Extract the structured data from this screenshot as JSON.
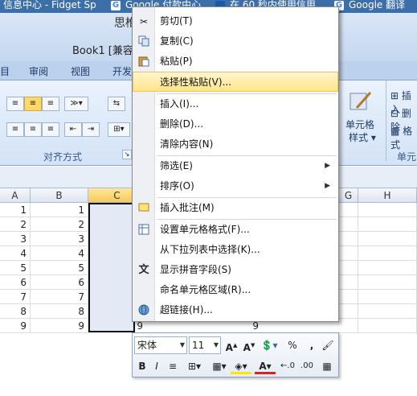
{
  "browser_tabs": [
    {
      "label": "信息中心 - Fidget Sp",
      "icon": "page-icon"
    },
    {
      "label": "Google 付款中心",
      "icon": "google-icon"
    },
    {
      "label": "在 60 秒内使用信用",
      "icon": "wave-icon"
    },
    {
      "label": "Google 翻译",
      "icon": "google-icon"
    }
  ],
  "window": {
    "partial_title": "思椎",
    "document_title": "Book1  [兼容"
  },
  "ribbon": {
    "tabs": [
      "目",
      "审阅",
      "视图",
      "开发"
    ],
    "group_alignment_label": "对齐方式",
    "cell_styles_label_line1": "单元格",
    "cell_styles_label_line2": "样式",
    "insert_label": "插入",
    "delete_label": "删除",
    "format_label": "格式",
    "cells_group_label": "单元"
  },
  "sheet": {
    "columns": [
      "A",
      "B",
      "C",
      "D",
      "E",
      "F",
      "G",
      "H"
    ],
    "selected_column": "C",
    "col_a_values": [
      "1",
      "2",
      "3",
      "4",
      "5",
      "6",
      "7",
      "8",
      "9"
    ],
    "col_b_values": [
      "1",
      "2",
      "3",
      "4",
      "5",
      "6",
      "7",
      "8",
      "9"
    ],
    "col_c_last": "9",
    "col_f_last": "9"
  },
  "context_menu": {
    "items": [
      {
        "label": "剪切(T)",
        "icon": "scissors-icon"
      },
      {
        "label": "复制(C)",
        "icon": "copy-icon"
      },
      {
        "label": "粘贴(P)",
        "icon": "paste-icon"
      },
      {
        "label": "选择性粘贴(V)...",
        "icon": "",
        "highlighted": true
      },
      {
        "label": "插入(I)...",
        "icon": ""
      },
      {
        "label": "删除(D)...",
        "icon": ""
      },
      {
        "label": "清除内容(N)",
        "icon": ""
      },
      {
        "label": "筛选(E)",
        "icon": "",
        "submenu": true
      },
      {
        "label": "排序(O)",
        "icon": "",
        "submenu": true
      },
      {
        "label": "插入批注(M)",
        "icon": "comment-icon"
      },
      {
        "label": "设置单元格格式(F)...",
        "icon": "format-cells-icon"
      },
      {
        "label": "从下拉列表中选择(K)...",
        "icon": ""
      },
      {
        "label": "显示拼音字段(S)",
        "icon": "phonetic-icon"
      },
      {
        "label": "命名单元格区域(R)...",
        "icon": ""
      },
      {
        "label": "超链接(H)...",
        "icon": "hyperlink-icon"
      }
    ]
  },
  "mini_toolbar": {
    "font_name": "宋体",
    "font_size": "11",
    "percent": "%",
    "comma": ","
  },
  "colors": {
    "menu_highlight": "#ffe48a",
    "ribbon_bg": "#d3e3f7",
    "browser_bar": "#3c6ea8"
  }
}
